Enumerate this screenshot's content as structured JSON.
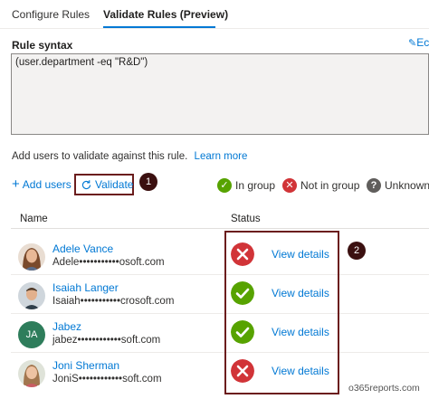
{
  "tabs": [
    {
      "label": "Configure Rules"
    },
    {
      "label": "Validate Rules (Preview)"
    }
  ],
  "rule": {
    "label": "Rule syntax",
    "edit_label": "Ec",
    "text": "(user.department -eq \"R&D\")"
  },
  "info": {
    "text": "Add users to validate against this rule.",
    "learn_more": "Learn more"
  },
  "toolbar": {
    "add_users": "Add users",
    "validate": "Validate"
  },
  "annotations": [
    "1",
    "2"
  ],
  "legend": [
    {
      "label": "In group",
      "color": "#57a300",
      "icon": "check-icon"
    },
    {
      "label": "Not in group",
      "color": "#d13438",
      "icon": "x-icon"
    },
    {
      "label": "Unknown",
      "color": "#605e5c",
      "icon": "question-icon"
    }
  ],
  "table": {
    "headers": {
      "name": "Name",
      "status": "Status"
    },
    "rows": [
      {
        "name": "Adele Vance",
        "email": "Adele•••••••••••osoft.com",
        "status": "not-in-group",
        "details": "View details"
      },
      {
        "name": "Isaiah Langer",
        "email": "Isaiah•••••••••••crosoft.com",
        "status": "in-group",
        "details": "View details"
      },
      {
        "name": "Jabez",
        "initials": "JA",
        "email": "jabez••••••••••••soft.com",
        "status": "in-group",
        "details": "View details"
      },
      {
        "name": "Joni Sherman",
        "email": "JoniS••••••••••••soft.com",
        "status": "not-in-group",
        "details": "View details"
      }
    ]
  },
  "watermark": "o365reports.com"
}
